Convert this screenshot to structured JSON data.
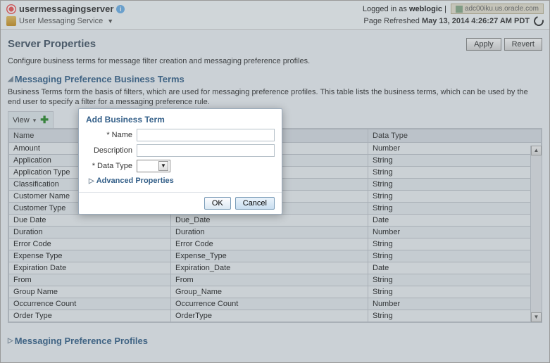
{
  "header": {
    "server_name": "usermessagingserver",
    "logged_in_prefix": "Logged in as ",
    "logged_in_user": "weblogic",
    "host": "adc00iku.us.oracle.com",
    "breadcrumb": "User Messaging Service",
    "refresh_prefix": "Page Refreshed ",
    "refresh_time": "May 13, 2014 4:26:27 AM PDT"
  },
  "page": {
    "title": "Server Properties",
    "apply": "Apply",
    "revert": "Revert",
    "desc": "Configure business terms for message filter creation and messaging preference profiles."
  },
  "section1": {
    "title": "Messaging Preference Business Terms",
    "desc": "Business Terms form the basis of filters, which are used for messaging preference profiles. This table lists the business terms, which can be used by the end user to specify a filter for a messaging preference rule.",
    "view": "View"
  },
  "table": {
    "col1": "Name",
    "col_mid": "",
    "col2": "Data Type",
    "rows": [
      {
        "name": "Amount",
        "mid": "",
        "type": "Number"
      },
      {
        "name": "Application",
        "mid": "",
        "type": "String"
      },
      {
        "name": "Application Type",
        "mid": "",
        "type": "String"
      },
      {
        "name": "Classification",
        "mid": "",
        "type": "String"
      },
      {
        "name": "Customer Name",
        "mid": "",
        "type": "String"
      },
      {
        "name": "Customer Type",
        "mid": "",
        "type": "String"
      },
      {
        "name": "Due Date",
        "mid": "Due_Date",
        "type": "Date"
      },
      {
        "name": "Duration",
        "mid": "Duration",
        "type": "Number"
      },
      {
        "name": "Error Code",
        "mid": "Error Code",
        "type": "String"
      },
      {
        "name": "Expense Type",
        "mid": "Expense_Type",
        "type": "String"
      },
      {
        "name": "Expiration Date",
        "mid": "Expiration_Date",
        "type": "Date"
      },
      {
        "name": "From",
        "mid": "From",
        "type": "String"
      },
      {
        "name": "Group Name",
        "mid": "Group_Name",
        "type": "String"
      },
      {
        "name": "Occurrence Count",
        "mid": "Occurrence Count",
        "type": "Number"
      },
      {
        "name": "Order Type",
        "mid": "OrderType",
        "type": "String"
      }
    ]
  },
  "section2": {
    "title": "Messaging Preference Profiles"
  },
  "modal": {
    "title": "Add Business Term",
    "name_label": "Name",
    "desc_label": "Description",
    "type_label": "Data Type",
    "advanced": "Advanced Properties",
    "ok": "OK",
    "cancel": "Cancel"
  }
}
